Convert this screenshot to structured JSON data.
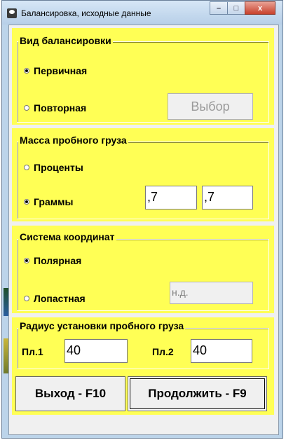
{
  "window": {
    "title": "Балансировка, исходные данные",
    "minimize_glyph": "–",
    "maximize_glyph": "□",
    "close_glyph": "x"
  },
  "balancing_type": {
    "legend": "Вид балансировки",
    "options": [
      {
        "label": "Первичная",
        "selected": true
      },
      {
        "label": "Повторная",
        "selected": false
      }
    ],
    "select_button": "Выбор"
  },
  "trial_mass": {
    "legend": "Масса пробного груза",
    "options": [
      {
        "label": "Проценты",
        "selected": false
      },
      {
        "label": "Граммы",
        "selected": true
      }
    ],
    "field1": ",7",
    "field2": ",7"
  },
  "coordinate_system": {
    "legend": "Система координат",
    "options": [
      {
        "label": "Полярная",
        "selected": true
      },
      {
        "label": "Лопастная",
        "selected": false
      }
    ],
    "field": "н.д."
  },
  "install_radius": {
    "legend": "Радиус установки пробного груза",
    "plane1_label": "Пл.1",
    "plane1_value": "40",
    "plane2_label": "Пл.2",
    "plane2_value": "40"
  },
  "buttons": {
    "exit": "Выход - F10",
    "continue": "Продолжить - F9"
  },
  "colors": {
    "panel": "#ffff55",
    "window_frame": "#bcd4ea",
    "close_button": "#c8412c"
  }
}
